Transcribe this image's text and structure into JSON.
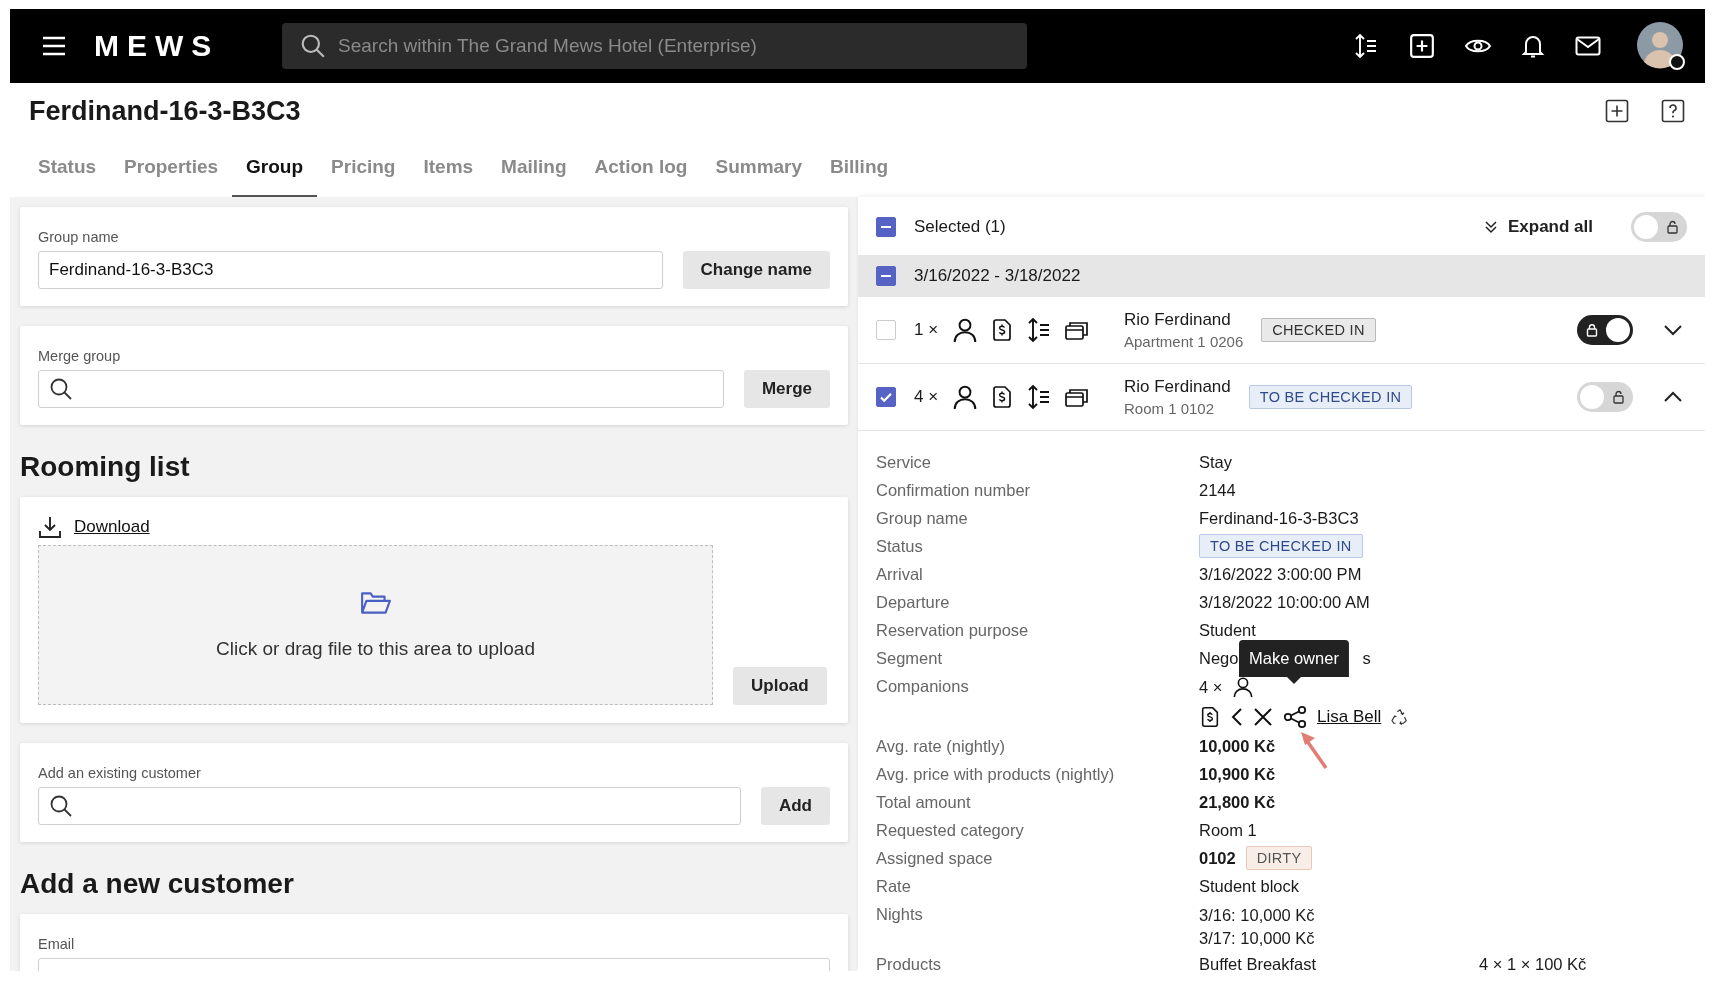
{
  "app": {
    "logo": "MEWS",
    "search_placeholder": "Search within The Grand Mews Hotel (Enterprise)"
  },
  "page_title": "Ferdinand-16-3-B3C3",
  "tabs": [
    {
      "label": "Status",
      "selected": false
    },
    {
      "label": "Properties",
      "selected": false
    },
    {
      "label": "Group",
      "selected": true
    },
    {
      "label": "Pricing",
      "selected": false
    },
    {
      "label": "Items",
      "selected": false
    },
    {
      "label": "Mailing",
      "selected": false
    },
    {
      "label": "Action log",
      "selected": false
    },
    {
      "label": "Summary",
      "selected": false
    },
    {
      "label": "Billing",
      "selected": false
    }
  ],
  "group_name": {
    "label": "Group name",
    "value": "Ferdinand-16-3-B3C3",
    "button": "Change name"
  },
  "merge_group": {
    "label": "Merge group",
    "button": "Merge"
  },
  "rooming_list": {
    "heading": "Rooming list",
    "download": "Download",
    "drop_text": "Click or drag file to this area to upload",
    "button": "Upload"
  },
  "existing_customer": {
    "label": "Add an existing customer",
    "button": "Add"
  },
  "new_customer": {
    "heading": "Add a new customer",
    "email_label": "Email"
  },
  "selection": {
    "label": "Selected (1)",
    "indeterminate": true,
    "expand_all": "Expand all",
    "on": false
  },
  "date_group": {
    "label": "3/16/2022 - 3/18/2022",
    "indeterminate": true
  },
  "reservations": [
    {
      "count": "1 ×",
      "name": "Rio Ferdinand",
      "room": "Apartment 1 0206",
      "status": {
        "text": "CHECKED IN",
        "kind": "neutral"
      },
      "checked": false,
      "locked": true,
      "expanded": false
    },
    {
      "count": "4 ×",
      "name": "Rio Ferdinand",
      "room": "Room 1 0102",
      "status": {
        "text": "TO BE CHECKED IN",
        "kind": "info"
      },
      "checked": true,
      "locked": false,
      "expanded": true
    }
  ],
  "details": [
    {
      "label": "Service",
      "kind": "text",
      "value": "Stay"
    },
    {
      "label": "Confirmation number",
      "kind": "text",
      "value": "2144"
    },
    {
      "label": "Group name",
      "kind": "text",
      "value": "Ferdinand-16-3-B3C3"
    },
    {
      "label": "Status",
      "kind": "badge",
      "badge": {
        "text": "TO BE CHECKED IN",
        "kind": "info"
      }
    },
    {
      "label": "Arrival",
      "kind": "text",
      "value": "3/16/2022 3:00:00 PM"
    },
    {
      "label": "Departure",
      "kind": "text",
      "value": "3/18/2022 10:00:00 AM"
    },
    {
      "label": "Reservation purpose",
      "kind": "text",
      "value": "Student"
    },
    {
      "label": "Segment",
      "kind": "obscured",
      "value_start": "Nego",
      "value_end": "s"
    },
    {
      "label": "Companions",
      "kind": "companions",
      "count": "4 ×",
      "companion": "Lisa Bell",
      "tooltip": "Make owner"
    },
    {
      "label": "Avg. rate (nightly)",
      "kind": "amount",
      "value": "10,000 Kč"
    },
    {
      "label": "Avg. price with products (nightly)",
      "kind": "amount",
      "value": "10,900 Kč"
    },
    {
      "label": "Total amount",
      "kind": "amount",
      "value": "21,800 Kč"
    },
    {
      "label": "Requested category",
      "kind": "text",
      "value": "Room 1"
    },
    {
      "label": "Assigned space",
      "kind": "space",
      "value": "0102",
      "badge": {
        "text": "DIRTY",
        "kind": "warning"
      }
    },
    {
      "label": "Rate",
      "kind": "text",
      "value": "Student block"
    },
    {
      "label": "Nights",
      "kind": "lines",
      "lines": [
        "3/16: 10,000 Kč",
        "3/17: 10,000 Kč"
      ]
    },
    {
      "label": "Products",
      "kind": "product",
      "value": "Buffet Breakfast",
      "extra": "4 × 1 × 100 Kč"
    }
  ]
}
